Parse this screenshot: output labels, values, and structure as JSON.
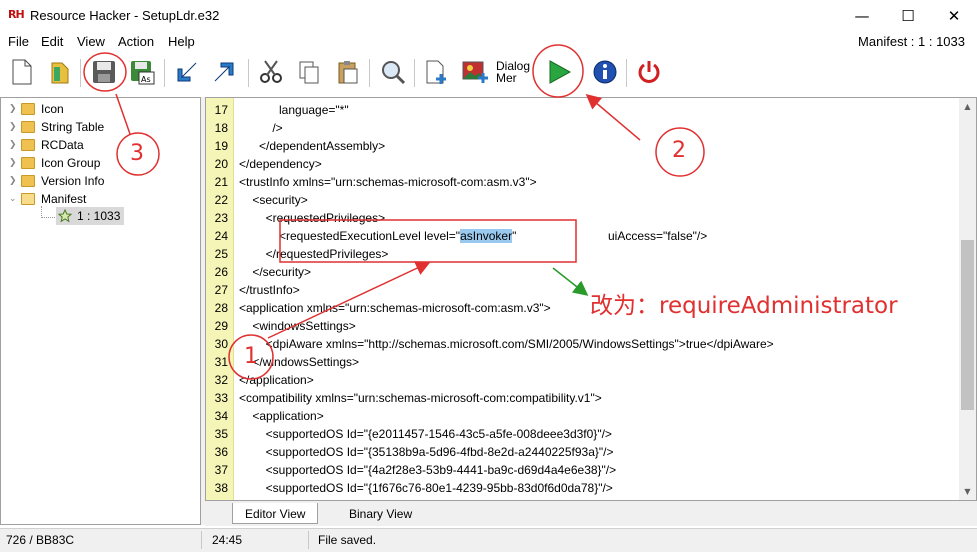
{
  "window": {
    "logo": "RH",
    "title": "Resource Hacker - SetupLdr.e32",
    "minimize": "—",
    "maximize": "☐",
    "close": "✕"
  },
  "menu": {
    "file": "File",
    "edit": "Edit",
    "view": "View",
    "action": "Action",
    "help": "Help",
    "resource_id": "Manifest : 1 : 1033"
  },
  "toolbar": {
    "dialog_menu_label_1": "Dialog",
    "dialog_menu_label_2": "Mer"
  },
  "tree": {
    "items": [
      "Icon",
      "String Table",
      "RCData",
      "Icon Group",
      "Version Info",
      "Manifest"
    ],
    "child": "1 : 1033"
  },
  "editor": {
    "line_numbers": [
      "17",
      "18",
      "19",
      "20",
      "21",
      "22",
      "23",
      "24",
      "25",
      "26",
      "27",
      "28",
      "29",
      "30",
      "31",
      "32",
      "33",
      "34",
      "35",
      "36",
      "37",
      "38"
    ],
    "lines": [
      "            language=\"*\"",
      "          />",
      "      </dependentAssembly>",
      "</dependency>",
      "<trustInfo xmlns=\"urn:schemas-microsoft-com:asm.v3\">",
      "    <security>",
      "        <requestedPrivileges>",
      "            <requestedExecutionLevel level=\"",
      "        </requestedPrivileges>",
      "    </security>",
      "</trustInfo>",
      "<application xmlns=\"urn:schemas-microsoft-com:asm.v3\">",
      "    <windowsSettings>",
      "        <dpiAware xmlns=\"http://schemas.microsoft.com/SMI/2005/WindowsSettings\">true</dpiAware>",
      "    </windowsSettings>",
      "</application>",
      "<compatibility xmlns=\"urn:schemas-microsoft-com:compatibility.v1\">",
      "    <application>",
      "        <supportedOS Id=\"{e2011457-1546-43c5-a5fe-008deee3d3f0}\"/>",
      "        <supportedOS Id=\"{35138b9a-5d96-4fbd-8e2d-a2440225f93a}\"/>",
      "        <supportedOS Id=\"{4a2f28e3-53b9-4441-ba9c-d69d4a4e6e38}\"/>",
      "        <supportedOS Id=\"{1f676c76-80e1-4239-95bb-83d0f6d0da78}\"/>"
    ],
    "selected_text": "asInvoker",
    "line24_tail": "\"",
    "line24_ui_access": "uiAccess=\"false\"/>"
  },
  "tabs": {
    "editor_view": "Editor View",
    "binary_view": "Binary View"
  },
  "status": {
    "offset": "726 / BB83C",
    "position": "24:45",
    "message": "File saved."
  },
  "annotations": {
    "instruction": "改为：requireAdministrator",
    "circle_1": "1",
    "circle_2": "2",
    "circle_3": "3",
    "color": "#e03030",
    "green_arrow_color": "#2a9a2a"
  }
}
